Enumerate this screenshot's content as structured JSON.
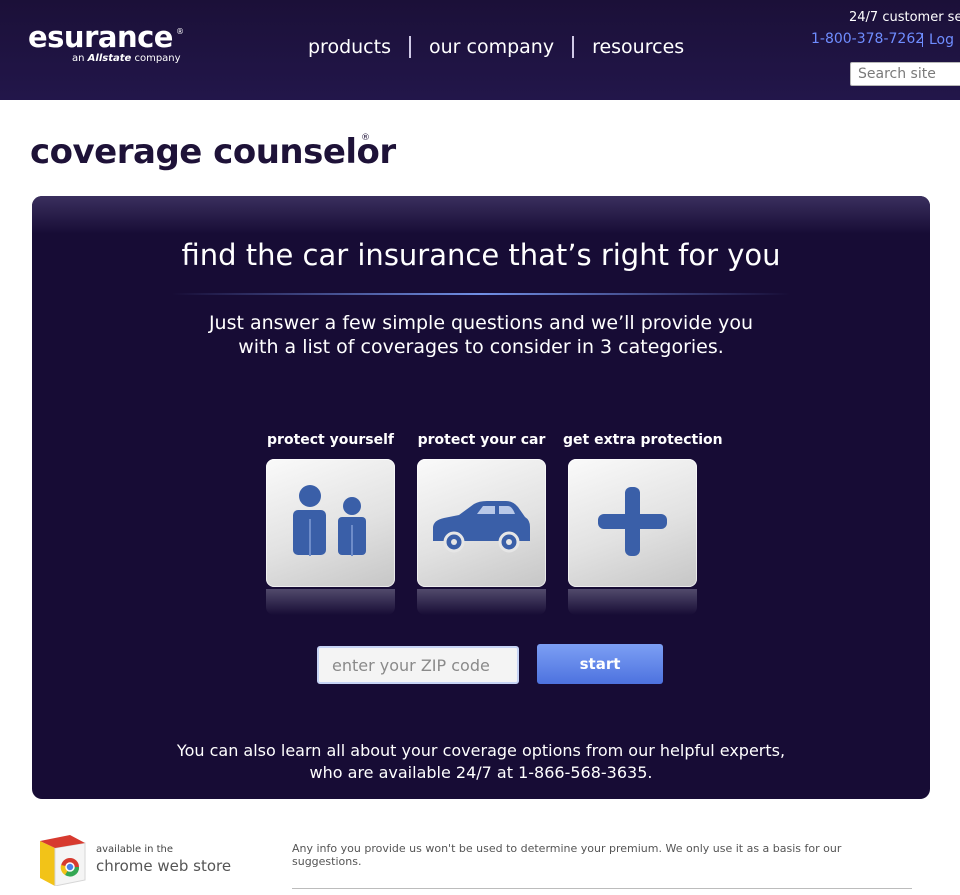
{
  "header": {
    "logo": {
      "name": "esurance",
      "reg": "®",
      "tagline_prefix": "an ",
      "tagline_brand": "Allstate",
      "tagline_suffix": " company"
    },
    "nav": [
      {
        "label": "products"
      },
      {
        "label": "our company"
      },
      {
        "label": "resources"
      }
    ],
    "service_text": "24/7 customer se",
    "phone": "1-800-378-7262",
    "login_text": "Log",
    "search_placeholder": "Search site"
  },
  "page": {
    "title": "coverage counselor",
    "title_reg": "®"
  },
  "panel": {
    "headline": "find the car insurance that’s right for you",
    "intro_line1": "Just answer a few simple questions and we’ll provide you",
    "intro_line2": "with a list of coverages to consider in 3 categories.",
    "categories": [
      {
        "label": "protect yourself",
        "icon": "people-icon"
      },
      {
        "label": "protect your car",
        "icon": "car-icon"
      },
      {
        "label": "get extra protection",
        "icon": "plus-icon"
      }
    ],
    "zip_placeholder": "enter your ZIP code",
    "start_label": "start",
    "footer_line1": "You can also learn all about your coverage options from our helpful experts,",
    "footer_line2": "who are available 24/7 at 1-866-568-3635."
  },
  "footer": {
    "chrome_available": "available in the",
    "chrome_store": "chrome web store",
    "disclaimer": "Any info you provide us won't be used to determine your premium. We only use it as a basis for our suggestions."
  },
  "colors": {
    "header_bg": "#1b1038",
    "panel_bg": "#170c35",
    "link_blue": "#6f8dff",
    "button_blue": "#5f86ea",
    "icon_blue": "#3a5fa8",
    "title_dark": "#1e1238"
  }
}
